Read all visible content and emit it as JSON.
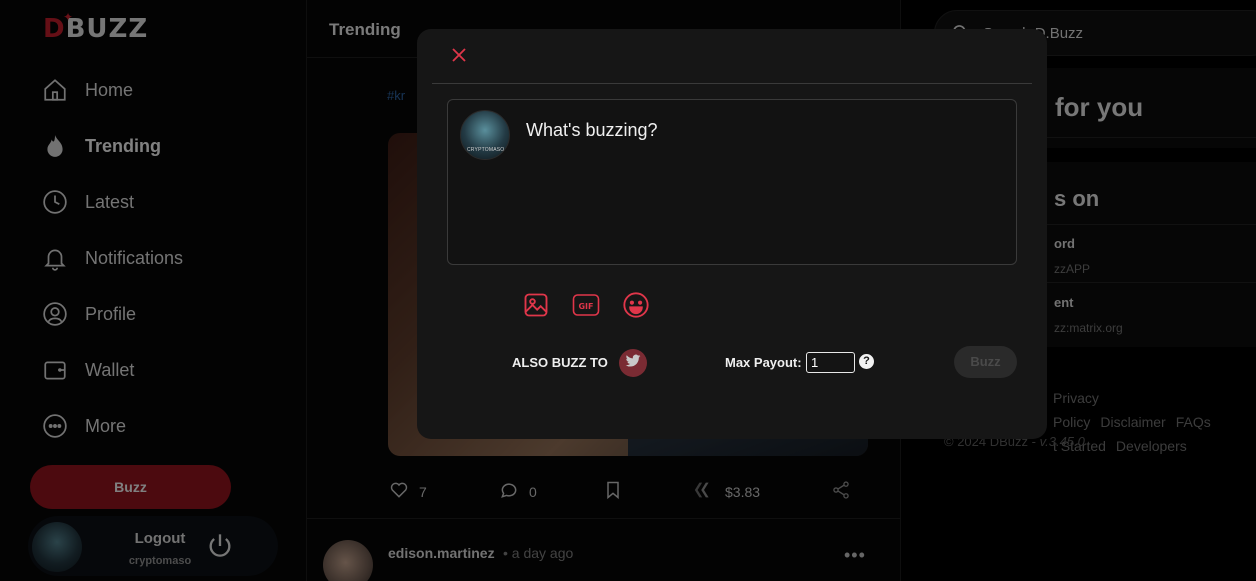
{
  "brand": {
    "logo_d": "D",
    "logo_rest": "BUZZ"
  },
  "nav": [
    {
      "label": "Home",
      "icon": "home-icon"
    },
    {
      "label": "Trending",
      "icon": "flame-icon",
      "active": true
    },
    {
      "label": "Latest",
      "icon": "clock-icon"
    },
    {
      "label": "Notifications",
      "icon": "bell-icon"
    },
    {
      "label": "Profile",
      "icon": "user-icon"
    },
    {
      "label": "Wallet",
      "icon": "wallet-icon"
    },
    {
      "label": "More",
      "icon": "more-icon"
    }
  ],
  "sidebar": {
    "buzz_label": "Buzz",
    "logout_label": "Logout",
    "username": "cryptomaso"
  },
  "feed": {
    "title": "Trending",
    "hashtag": "#kr",
    "likes": "7",
    "comments": "0",
    "payout": "$3.83",
    "next_author": "edison.martinez",
    "next_time": "• a day ago"
  },
  "right": {
    "search_placeholder": "Search D.Buzz",
    "panel1_title": "for you",
    "panel2_title": "s on",
    "link1_title": "ord",
    "link1_value": "zzAPP",
    "link2_title": "ent",
    "link2_value": "zz:matrix.org",
    "footer_row1": [
      "Privacy Policy",
      "Disclaimer",
      "FAQs"
    ],
    "footer_row2": [
      "t Started",
      "Developers"
    ],
    "copyright": "© 2024 DBuzz",
    "version": "v.3.45.0"
  },
  "modal": {
    "placeholder": "What's buzzing?",
    "avatar_tag": "CRYPTOMASO",
    "also_buzz_to": "ALSO BUZZ TO",
    "max_payout_label": "Max Payout:",
    "max_payout_value": "1",
    "help": "?",
    "submit_label": "Buzz"
  },
  "colors": {
    "accent": "#e0364a",
    "brand_red": "#8a131c",
    "bg": "#000000",
    "modal_bg": "#161616"
  }
}
